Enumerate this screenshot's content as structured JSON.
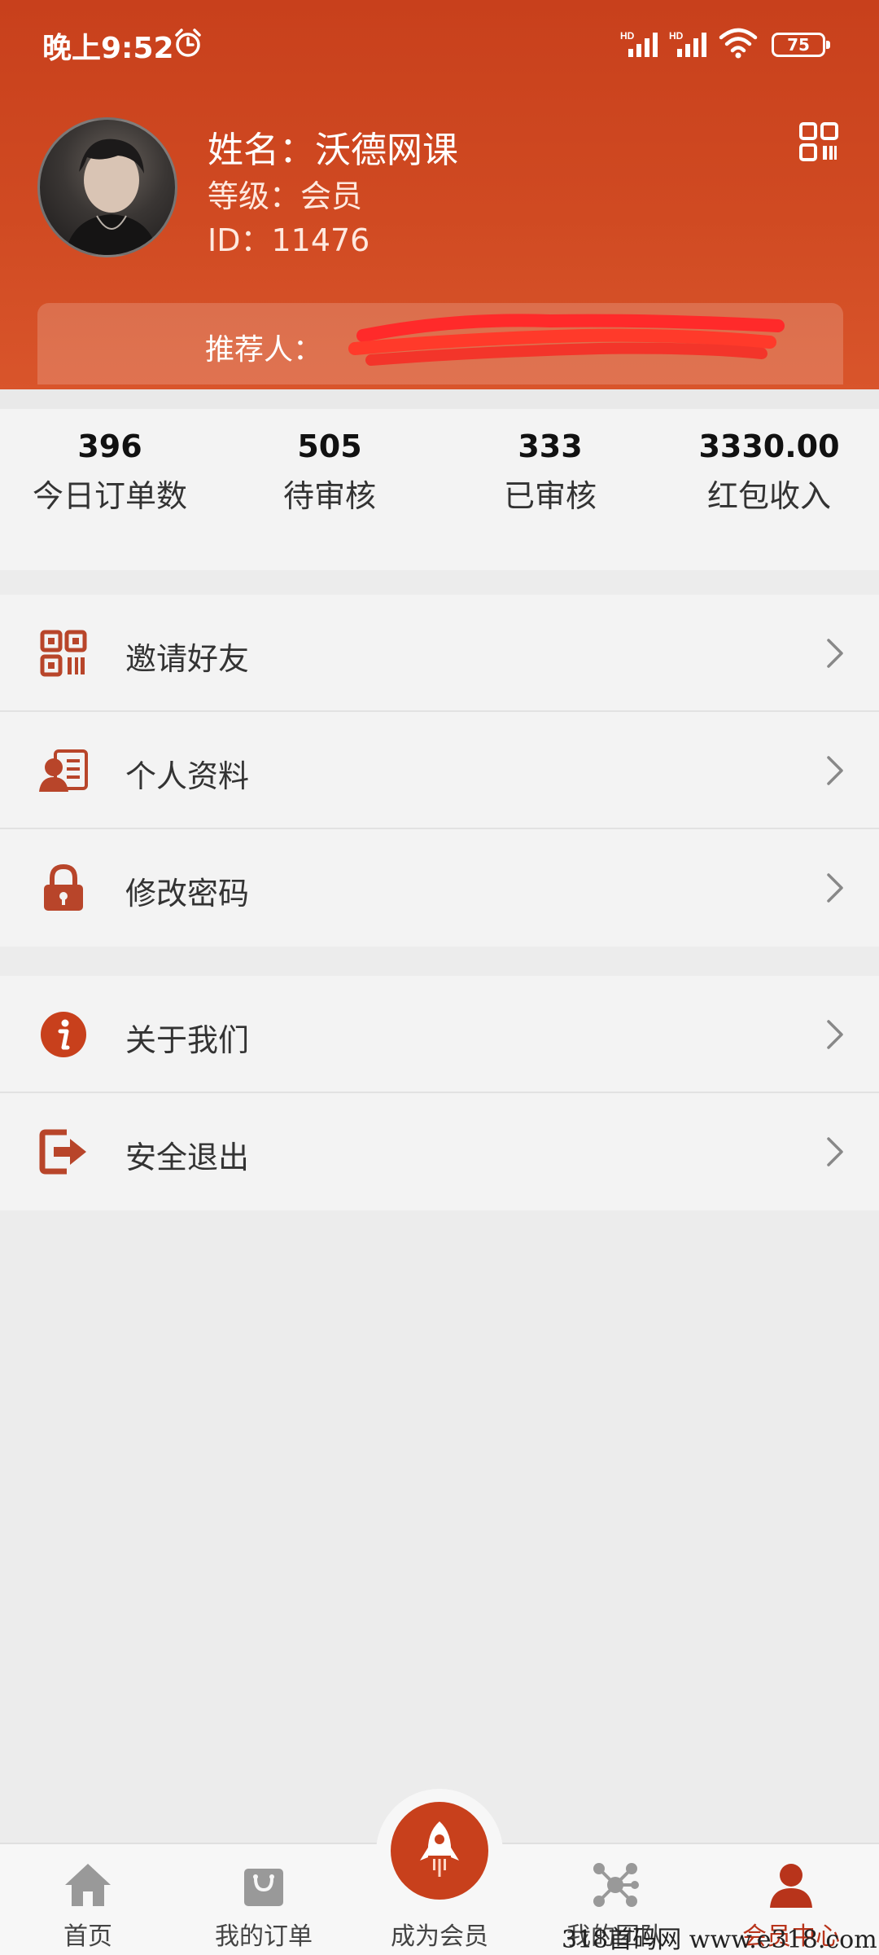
{
  "status_bar": {
    "time": "晚上9:52",
    "battery": "75",
    "network_1": "HD",
    "network_2": "HD"
  },
  "profile": {
    "name_line": "姓名：沃德网课",
    "level_line": "等级：会员",
    "id_line": "ID：11476",
    "referrer_label": "推荐人："
  },
  "stats": [
    {
      "value": "396",
      "label": "今日订单数"
    },
    {
      "value": "505",
      "label": "待审核"
    },
    {
      "value": "333",
      "label": "已审核"
    },
    {
      "value": "3330.00",
      "label": "红包收入"
    }
  ],
  "menu_group_1": [
    {
      "label": "邀请好友",
      "icon": "qr-code-icon"
    },
    {
      "label": "个人资料",
      "icon": "profile-card-icon"
    },
    {
      "label": "修改密码",
      "icon": "lock-icon"
    }
  ],
  "menu_group_2": [
    {
      "label": "关于我们",
      "icon": "info-icon"
    },
    {
      "label": "安全退出",
      "icon": "logout-icon"
    }
  ],
  "tabbar": [
    {
      "label": "首页",
      "icon": "home-icon"
    },
    {
      "label": "我的订单",
      "icon": "shopping-bag-icon"
    },
    {
      "label": "成为会员",
      "icon": "rocket-icon"
    },
    {
      "label": "我的团队",
      "icon": "network-icon"
    },
    {
      "label": "会员中心",
      "icon": "user-icon"
    }
  ],
  "watermark": "318首码网 www.e318.com",
  "colors": {
    "primary": "#c8401c",
    "icon_accent": "#b8452a",
    "background": "#ececec",
    "card": "#f3f3f3"
  }
}
